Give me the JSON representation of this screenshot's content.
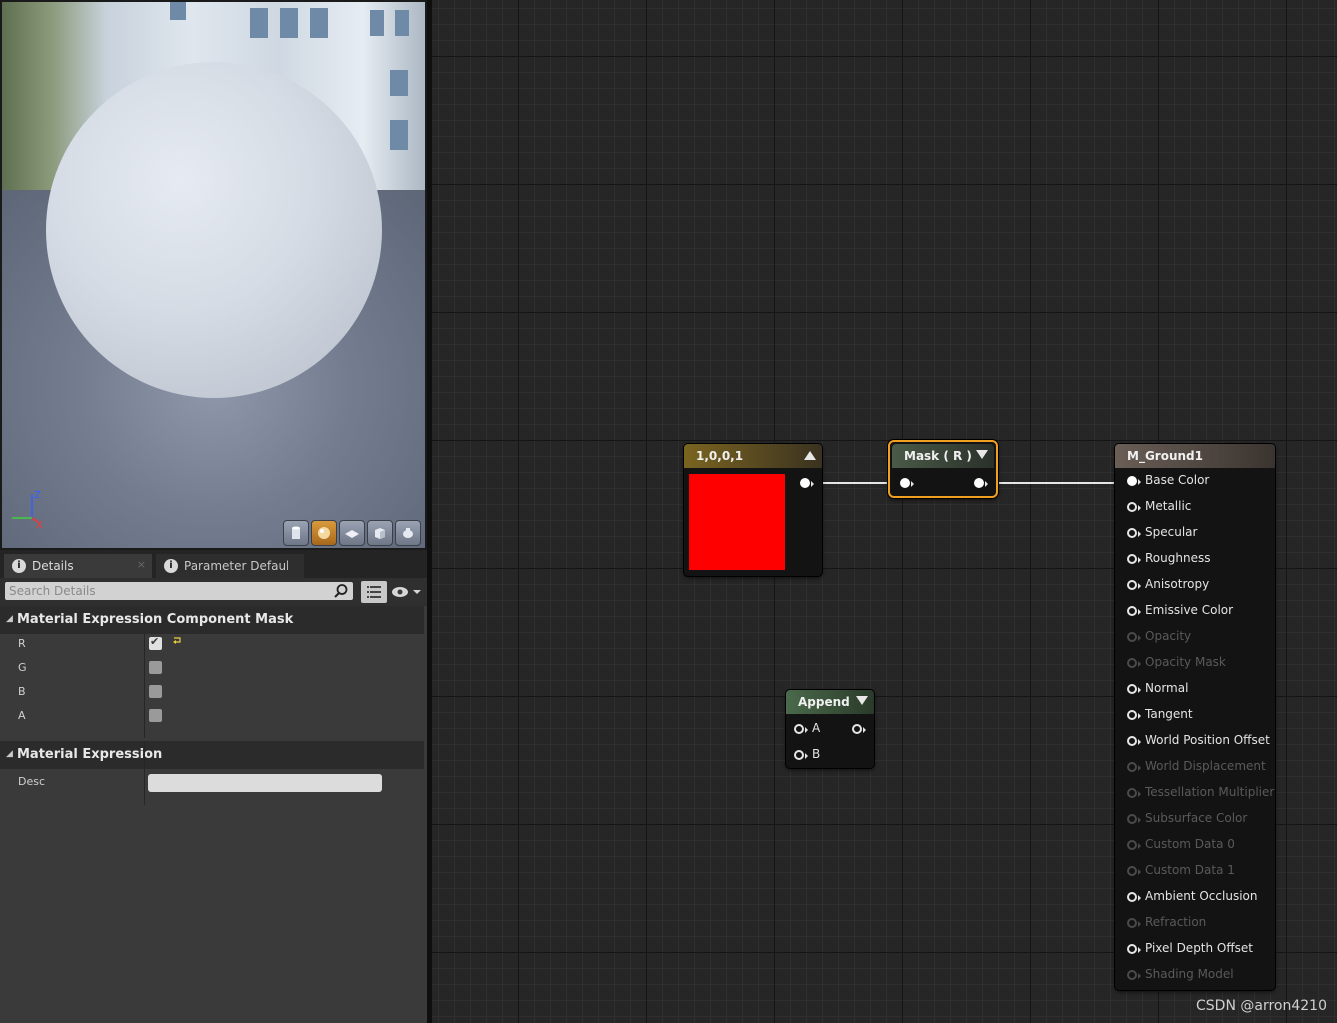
{
  "viewport": {
    "axis": {
      "z": "Z",
      "y": "Y",
      "x": "X"
    },
    "buttons": [
      {
        "name": "cylinder-preview-button",
        "active": false
      },
      {
        "name": "sphere-preview-button",
        "active": true
      },
      {
        "name": "plane-preview-button",
        "active": false
      },
      {
        "name": "cube-preview-button",
        "active": false
      },
      {
        "name": "custom-mesh-preview-button",
        "active": false
      }
    ]
  },
  "details": {
    "tabs": [
      {
        "label": "Details",
        "close": "×"
      },
      {
        "label": "Parameter Defaults"
      }
    ],
    "search": {
      "placeholder": "Search Details"
    },
    "categories": [
      {
        "title": "Material Expression Component Mask",
        "properties": [
          {
            "label": "R",
            "checked": true
          },
          {
            "label": "G",
            "checked": false
          },
          {
            "label": "B",
            "checked": false
          },
          {
            "label": "A",
            "checked": false
          }
        ]
      },
      {
        "title": "Material Expression",
        "properties": [
          {
            "label": "Desc",
            "value": ""
          }
        ]
      }
    ]
  },
  "graph": {
    "constant_node": {
      "title": "1,0,0,1",
      "color": "#ff0000",
      "header_color": "#7a6420"
    },
    "mask_node": {
      "title": "Mask ( R )",
      "header_color": "#3c4a3a",
      "selected_color": "#f0a020"
    },
    "append_node": {
      "title": "Append",
      "inputs": [
        "A",
        "B"
      ],
      "header_color": "#4a6a4a"
    },
    "result_node": {
      "title": "M_Ground1",
      "header_color": "#5a4f48",
      "inputs": [
        {
          "label": "Base Color",
          "enabled": true,
          "connected": true
        },
        {
          "label": "Metallic",
          "enabled": true
        },
        {
          "label": "Specular",
          "enabled": true
        },
        {
          "label": "Roughness",
          "enabled": true
        },
        {
          "label": "Anisotropy",
          "enabled": true
        },
        {
          "label": "Emissive Color",
          "enabled": true
        },
        {
          "label": "Opacity",
          "enabled": false
        },
        {
          "label": "Opacity Mask",
          "enabled": false
        },
        {
          "label": "Normal",
          "enabled": true
        },
        {
          "label": "Tangent",
          "enabled": true
        },
        {
          "label": "World Position Offset",
          "enabled": true
        },
        {
          "label": "World Displacement",
          "enabled": false
        },
        {
          "label": "Tessellation Multiplier",
          "enabled": false
        },
        {
          "label": "Subsurface Color",
          "enabled": false
        },
        {
          "label": "Custom Data 0",
          "enabled": false
        },
        {
          "label": "Custom Data 1",
          "enabled": false
        },
        {
          "label": "Ambient Occlusion",
          "enabled": true
        },
        {
          "label": "Refraction",
          "enabled": false
        },
        {
          "label": "Pixel Depth Offset",
          "enabled": true
        },
        {
          "label": "Shading Model",
          "enabled": false
        }
      ]
    }
  },
  "watermark": "CSDN @arron4210"
}
